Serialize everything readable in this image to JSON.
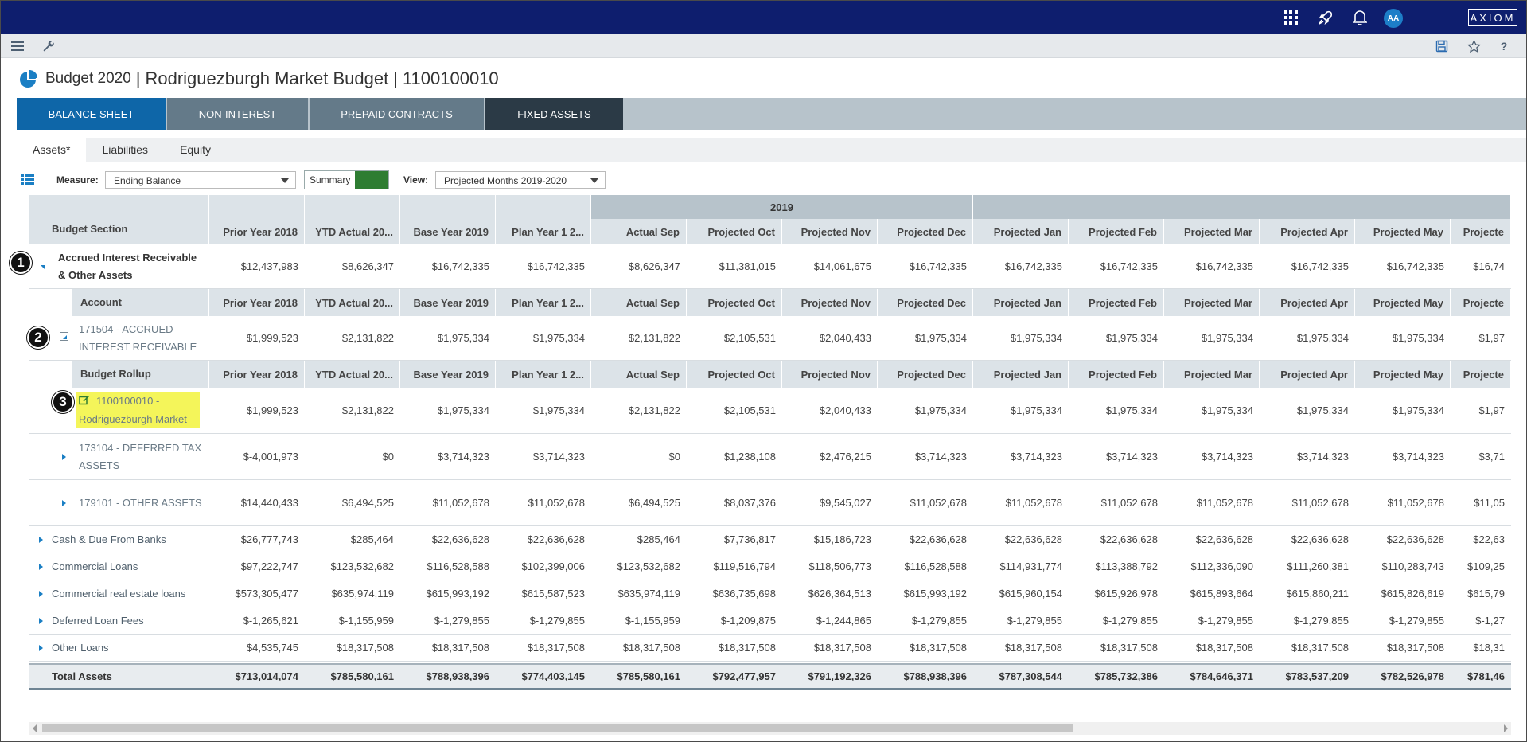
{
  "topbar": {
    "brand": "AXIOM",
    "avatar_initials": "AA",
    "icons": [
      "apps-grid-icon",
      "rocket-icon",
      "bell-icon"
    ]
  },
  "toolbar": {
    "left_icons": [
      "menu-icon",
      "wrench-icon"
    ],
    "right_icons": [
      "save-icon",
      "star-icon",
      "help-icon"
    ]
  },
  "page": {
    "title_part1": "Budget 2020",
    "title_part2": "Rodriguezburgh Market Budget",
    "title_part3": "1100100010",
    "separator": "|"
  },
  "main_tabs": [
    "BALANCE SHEET",
    "NON-INTEREST",
    "PREPAID CONTRACTS",
    "FIXED ASSETS"
  ],
  "sub_tabs": [
    "Assets*",
    "Liabilities",
    "Equity"
  ],
  "filters": {
    "measure_label": "Measure:",
    "measure_value": "Ending Balance",
    "toggle_label": "Summary",
    "view_label": "View:",
    "view_value": "Projected Months 2019-2020"
  },
  "grid": {
    "year_label": "2019",
    "section_header": "Budget Section",
    "account_header": "Account",
    "rollup_header": "Budget Rollup",
    "columns": [
      "Prior Year 2018",
      "YTD Actual 20...",
      "Base Year 2019",
      "Plan Year 1 2...",
      "Actual Sep",
      "Projected Oct",
      "Projected Nov",
      "Projected Dec",
      "Projected Jan",
      "Projected Feb",
      "Projected Mar",
      "Projected Apr",
      "Projected May",
      "Projecte"
    ],
    "rows": [
      {
        "label": "Accrued Interest Receivable & Other Assets",
        "values": [
          "$12,437,983",
          "$8,626,347",
          "$16,742,335",
          "$16,742,335",
          "$8,626,347",
          "$11,381,015",
          "$14,061,675",
          "$16,742,335",
          "$16,742,335",
          "$16,742,335",
          "$16,742,335",
          "$16,742,335",
          "$16,742,335",
          "$16,74"
        ]
      },
      {
        "label": "171504 - ACCRUED INTEREST RECEIVABLE",
        "values": [
          "$1,999,523",
          "$2,131,822",
          "$1,975,334",
          "$1,975,334",
          "$2,131,822",
          "$2,105,531",
          "$2,040,433",
          "$1,975,334",
          "$1,975,334",
          "$1,975,334",
          "$1,975,334",
          "$1,975,334",
          "$1,975,334",
          "$1,97"
        ]
      },
      {
        "label": "1100100010 - Rodriguezburgh Market",
        "values": [
          "$1,999,523",
          "$2,131,822",
          "$1,975,334",
          "$1,975,334",
          "$2,131,822",
          "$2,105,531",
          "$2,040,433",
          "$1,975,334",
          "$1,975,334",
          "$1,975,334",
          "$1,975,334",
          "$1,975,334",
          "$1,975,334",
          "$1,97"
        ]
      },
      {
        "label": "173104 - DEFERRED TAX ASSETS",
        "values": [
          "$-4,001,973",
          "$0",
          "$3,714,323",
          "$3,714,323",
          "$0",
          "$1,238,108",
          "$2,476,215",
          "$3,714,323",
          "$3,714,323",
          "$3,714,323",
          "$3,714,323",
          "$3,714,323",
          "$3,714,323",
          "$3,71"
        ]
      },
      {
        "label": "179101 - OTHER ASSETS",
        "values": [
          "$14,440,433",
          "$6,494,525",
          "$11,052,678",
          "$11,052,678",
          "$6,494,525",
          "$8,037,376",
          "$9,545,027",
          "$11,052,678",
          "$11,052,678",
          "$11,052,678",
          "$11,052,678",
          "$11,052,678",
          "$11,052,678",
          "$11,05"
        ]
      },
      {
        "label": "Cash & Due From Banks",
        "values": [
          "$26,777,743",
          "$285,464",
          "$22,636,628",
          "$22,636,628",
          "$285,464",
          "$7,736,817",
          "$15,186,723",
          "$22,636,628",
          "$22,636,628",
          "$22,636,628",
          "$22,636,628",
          "$22,636,628",
          "$22,636,628",
          "$22,63"
        ]
      },
      {
        "label": "Commercial Loans",
        "values": [
          "$97,222,747",
          "$123,532,682",
          "$116,528,588",
          "$102,399,006",
          "$123,532,682",
          "$119,516,794",
          "$118,506,773",
          "$116,528,588",
          "$114,931,774",
          "$113,388,792",
          "$112,336,090",
          "$111,260,381",
          "$110,283,743",
          "$109,25"
        ]
      },
      {
        "label": "Commercial real estate loans",
        "values": [
          "$573,305,477",
          "$635,974,119",
          "$615,993,192",
          "$615,587,523",
          "$635,974,119",
          "$636,735,698",
          "$626,364,513",
          "$615,993,192",
          "$615,960,154",
          "$615,926,978",
          "$615,893,664",
          "$615,860,211",
          "$615,826,619",
          "$615,79"
        ]
      },
      {
        "label": "Deferred Loan Fees",
        "values": [
          "$-1,265,621",
          "$-1,155,959",
          "$-1,279,855",
          "$-1,279,855",
          "$-1,155,959",
          "$-1,209,875",
          "$-1,244,865",
          "$-1,279,855",
          "$-1,279,855",
          "$-1,279,855",
          "$-1,279,855",
          "$-1,279,855",
          "$-1,279,855",
          "$-1,27"
        ]
      },
      {
        "label": "Other Loans",
        "values": [
          "$4,535,745",
          "$18,317,508",
          "$18,317,508",
          "$18,317,508",
          "$18,317,508",
          "$18,317,508",
          "$18,317,508",
          "$18,317,508",
          "$18,317,508",
          "$18,317,508",
          "$18,317,508",
          "$18,317,508",
          "$18,317,508",
          "$18,31"
        ]
      },
      {
        "label": "Total Assets",
        "values": [
          "$713,014,074",
          "$785,580,161",
          "$788,938,396",
          "$774,403,145",
          "$785,580,161",
          "$792,477,957",
          "$791,192,326",
          "$788,938,396",
          "$787,308,544",
          "$785,732,386",
          "$784,646,371",
          "$783,537,209",
          "$782,526,978",
          "$781,46"
        ]
      }
    ]
  },
  "callouts": [
    "1",
    "2",
    "3"
  ]
}
